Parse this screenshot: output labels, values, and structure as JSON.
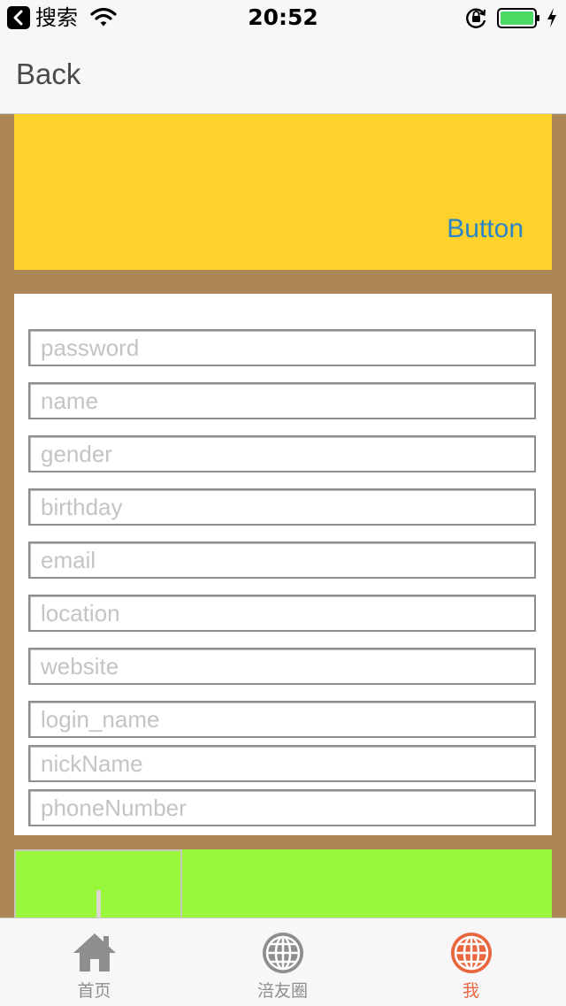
{
  "status_bar": {
    "back_app": "搜索",
    "time": "20:52",
    "icons": [
      "back-arrow-icon",
      "wifi-icon",
      "rotation-lock-icon",
      "battery-icon",
      "charging-bolt-icon"
    ]
  },
  "nav": {
    "back_label": "Back"
  },
  "yellow_panel": {
    "button_label": "Button",
    "background": "#fed22b",
    "button_color": "#2a84c6"
  },
  "form": {
    "fields": [
      {
        "placeholder": "password",
        "value": ""
      },
      {
        "placeholder": "name",
        "value": ""
      },
      {
        "placeholder": "gender",
        "value": ""
      },
      {
        "placeholder": "birthday",
        "value": ""
      },
      {
        "placeholder": "email",
        "value": ""
      },
      {
        "placeholder": "location",
        "value": ""
      },
      {
        "placeholder": "website",
        "value": ""
      },
      {
        "placeholder": "login_name",
        "value": ""
      },
      {
        "placeholder": "nickName",
        "value": ""
      },
      {
        "placeholder": "phoneNumber",
        "value": ""
      }
    ]
  },
  "green_panel": {
    "background": "#98f73a"
  },
  "tabbar": {
    "tabs": [
      {
        "label": "首页",
        "icon": "home-icon",
        "active": false
      },
      {
        "label": "涪友圈",
        "icon": "globe-icon",
        "active": false
      },
      {
        "label": "我",
        "icon": "globe-icon",
        "active": true
      }
    ],
    "active_color": "#e8673f",
    "inactive_color": "#8e8e8e"
  },
  "colors": {
    "background": "#ad8658",
    "bar": "#f7f7f9"
  }
}
